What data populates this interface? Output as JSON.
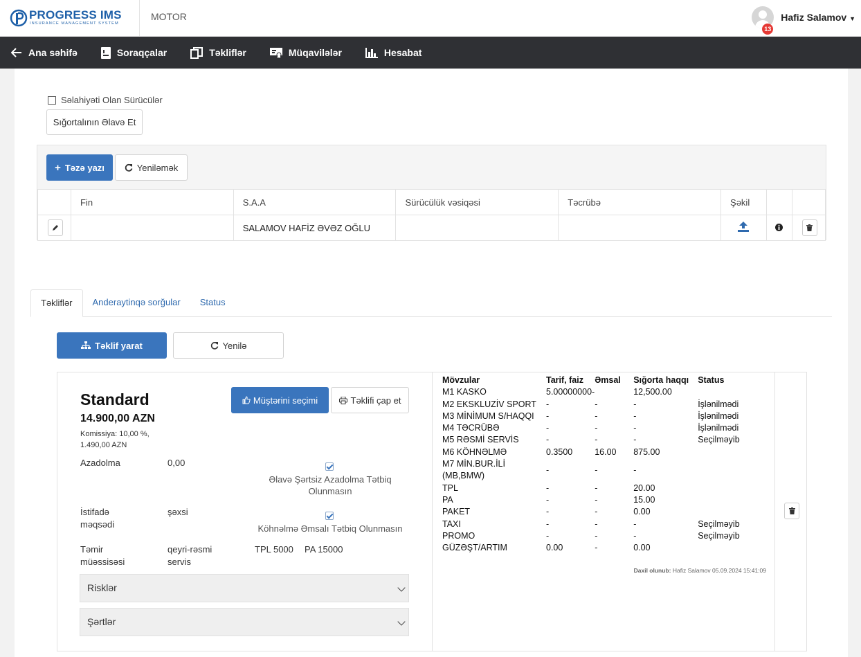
{
  "header": {
    "logo_title": "PROGRESS IMS",
    "logo_subtitle": "INSURANCE MANAGEMENT SYSTEM",
    "module": "MOTOR",
    "user_name": "Hafiz Salamov",
    "notification_count": "13"
  },
  "nav": {
    "home": "Ana səhifə",
    "requests": "Soraqçalar",
    "offers": "Təkliflər",
    "contracts": "Müqavilələr",
    "report": "Hesabat"
  },
  "drivers": {
    "authorized_label": "Səlahiyəti Olan Sürücülər",
    "add_insured_button": "Sığortalının Əlavə Et",
    "new_entry_button": "Təzə yazı",
    "refresh_button": "Yeniləmək",
    "columns": [
      "Fin",
      "S.A.A",
      "Sürücülük vəsiqəsi",
      "Təcrübə",
      "Şəkil"
    ],
    "rows": [
      {
        "fin": "",
        "name": "SALAMOV HAFİZ ƏVƏZ OĞLU",
        "license": "",
        "experience": ""
      }
    ]
  },
  "tabs": {
    "offers": "Təkliflər",
    "underwriting": "Anderaytinqə sorğular",
    "status": "Status"
  },
  "offer_actions": {
    "create_offer": "Təklif yarat",
    "refresh": "Yenilə"
  },
  "offer": {
    "title": "Standard",
    "price": "14.900,00 AZN",
    "commission_line1": "Komissiya: 10,00 %,",
    "commission_line2": "1.490,00 AZN",
    "select_button": "Müştərini seçimi",
    "print_button": "Təklifi çap et",
    "deductible_label": "Azadolma",
    "deductible_value": "0,00",
    "deductible_check": "Əlavə Şərtsiz Azadolma Tətbiq Olunmasın",
    "usage_label": "İstifadə məqsədi",
    "usage_value": "şəxsi",
    "depreciation_check": "Köhnəlmə Əmsalı Tətbiq Olunmasın",
    "repair_label": "Təmir müəssisəsi",
    "repair_value": "qeyri-rəsmi servis",
    "tpl": "TPL 5000",
    "pa": "PA 15000",
    "risks": "Risklər",
    "terms": "Şərtlər",
    "coverage_columns": [
      "Mövzular",
      "Tarif, faiz",
      "Əmsal",
      "Sığorta haqqı",
      "Status"
    ],
    "coverages": [
      {
        "name": "M1 KASKO",
        "rate": "5.00000000-",
        "coef": "",
        "premium": "12,500.00",
        "status": ""
      },
      {
        "name": "M2 EKSKLUZİV SPORT",
        "rate": "-",
        "coef": "-",
        "premium": "-",
        "status": "İşlənilmədi"
      },
      {
        "name": "M3 MİNİMUM S/HAQQI",
        "rate": "-",
        "coef": "-",
        "premium": "-",
        "status": "İşlənilmədi"
      },
      {
        "name": "M4 TƏCRÜBƏ",
        "rate": "-",
        "coef": "-",
        "premium": "-",
        "status": "İşlənilmədi"
      },
      {
        "name": "M5 RƏSMİ SERVİS",
        "rate": "-",
        "coef": "-",
        "premium": "-",
        "status": "Seçilməyib"
      },
      {
        "name": "M6 KÖHNƏLMƏ",
        "rate": "0.3500",
        "coef": "16.00",
        "premium": "875.00",
        "status": ""
      },
      {
        "name": "M7 MİN.BUR.İLİ (MB,BMW)",
        "rate": "-",
        "coef": "-",
        "premium": "-",
        "status": ""
      },
      {
        "name": "TPL",
        "rate": "-",
        "coef": "-",
        "premium": "20.00",
        "status": ""
      },
      {
        "name": "PA",
        "rate": "-",
        "coef": "-",
        "premium": "15.00",
        "status": ""
      },
      {
        "name": "PAKET",
        "rate": "-",
        "coef": "-",
        "premium": "0.00",
        "status": ""
      },
      {
        "name": "TAXI",
        "rate": "-",
        "coef": "-",
        "premium": "-",
        "status": "Seçilməyib"
      },
      {
        "name": "PROMO",
        "rate": "-",
        "coef": "-",
        "premium": "-",
        "status": "Seçilməyib"
      },
      {
        "name": "GÜZƏŞT/ARTIM",
        "rate": "0.00",
        "coef": "-",
        "premium": "0.00",
        "status": ""
      }
    ],
    "added_label": "Daxil olunub:",
    "added_value": "Hafiz Salamov 05.09.2024 15:41:09"
  }
}
